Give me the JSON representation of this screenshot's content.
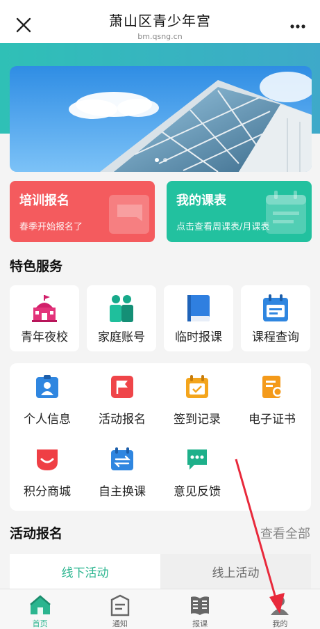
{
  "header": {
    "title": "萧山区青少年宫",
    "subtitle": "bm.qsng.cn",
    "close_icon": "close-icon",
    "more_icon": "more-icon"
  },
  "banner": {
    "image": "building-photo",
    "slide_count": 2,
    "active_slide": 1
  },
  "cards": [
    {
      "title": "培训报名",
      "subtitle": "春季开始报名了",
      "color": "#f45b5e"
    },
    {
      "title": "我的课表",
      "subtitle": "点击查看周课表/月课表",
      "color": "#22c19f"
    }
  ],
  "special": {
    "title": "特色服务",
    "items": [
      {
        "label": "青年夜校",
        "icon": "school-icon"
      },
      {
        "label": "家庭账号",
        "icon": "family-icon"
      },
      {
        "label": "临时报课",
        "icon": "book-icon"
      },
      {
        "label": "课程查询",
        "icon": "calendar-search-icon"
      }
    ]
  },
  "grid": {
    "items": [
      {
        "label": "个人信息",
        "icon": "profile-icon"
      },
      {
        "label": "活动报名",
        "icon": "flag-icon"
      },
      {
        "label": "签到记录",
        "icon": "checkin-icon"
      },
      {
        "label": "电子证书",
        "icon": "certificate-icon"
      },
      {
        "label": "积分商城",
        "icon": "shop-icon"
      },
      {
        "label": "自主换课",
        "icon": "swap-icon"
      },
      {
        "label": "意见反馈",
        "icon": "feedback-icon"
      }
    ]
  },
  "activity": {
    "title": "活动报名",
    "more": "查看全部",
    "tabs": [
      "线下活动",
      "线上活动"
    ]
  },
  "bottom_nav": [
    {
      "label": "首页",
      "icon": "home-icon"
    },
    {
      "label": "通知",
      "icon": "notice-icon"
    },
    {
      "label": "报课",
      "icon": "books-icon"
    },
    {
      "label": "我的",
      "icon": "user-icon"
    }
  ],
  "colors": {
    "accent": "#2bb58f",
    "red": "#f45b5e",
    "teal": "#22c19f",
    "annotation": "#e8293b"
  }
}
